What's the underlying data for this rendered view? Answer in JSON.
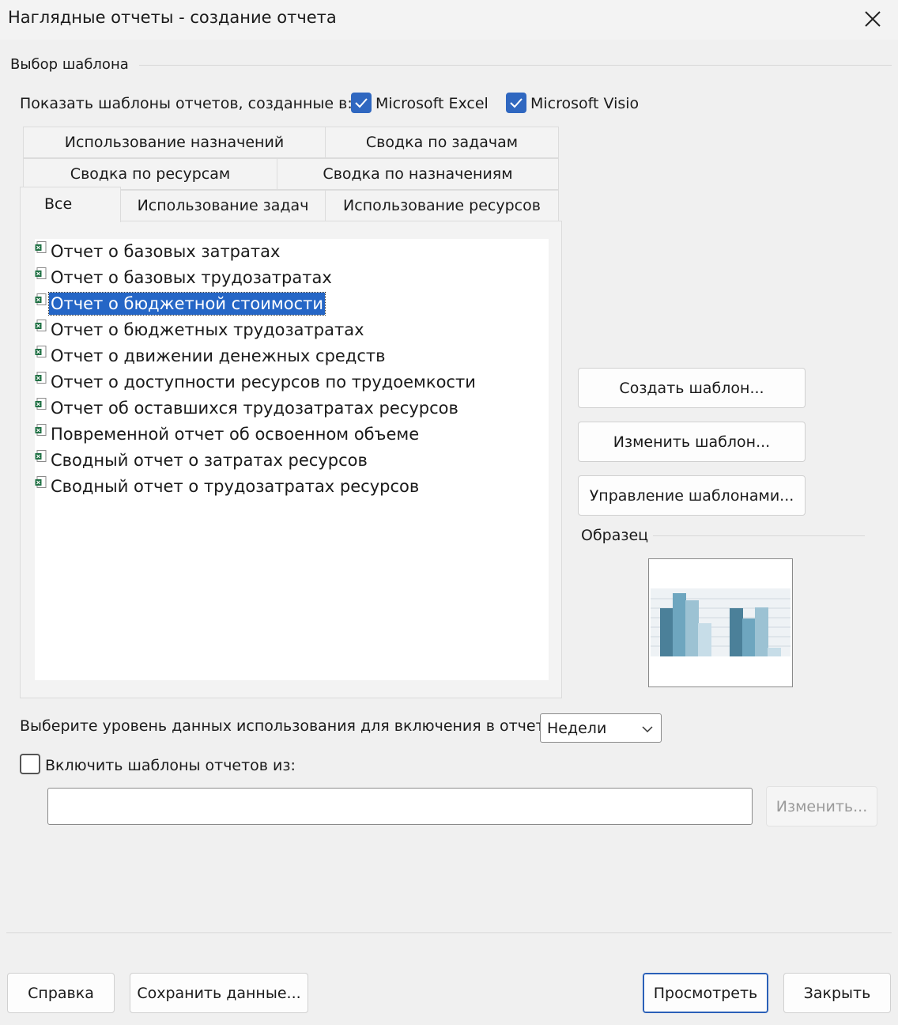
{
  "window": {
    "title": "Наглядные отчеты - создание отчета"
  },
  "template_group": {
    "label": "Выбор шаблона",
    "show_label": "Показать шаблоны отчетов, созданные в:",
    "excel": {
      "label": "Microsoft Excel",
      "checked": true
    },
    "visio": {
      "label": "Microsoft Visio",
      "checked": true
    }
  },
  "tabs": {
    "row1": [
      "Использование назначений",
      "Сводка по задачам"
    ],
    "row2": [
      "Сводка по ресурсам",
      "Сводка по назначениям"
    ],
    "row3": [
      "Все",
      "Использование задач",
      "Использование ресурсов"
    ],
    "active": "Все"
  },
  "reports": [
    "Отчет о базовых затратах",
    "Отчет о базовых трудозатратах",
    "Отчет о бюджетной стоимости",
    "Отчет о бюджетных трудозатратах",
    "Отчет о движении денежных средств",
    "Отчет о доступности ресурсов по трудоемкости",
    "Отчет об оставшихся трудозатратах ресурсов",
    "Повременной отчет об освоенном объеме",
    "Сводный отчет о затратах ресурсов",
    "Сводный отчет о трудозатратах ресурсов"
  ],
  "selected_report": "Отчет о бюджетной стоимости",
  "side_buttons": {
    "create": "Создать шаблон...",
    "edit": "Изменить шаблон...",
    "manage": "Управление шаблонами..."
  },
  "sample": {
    "label": "Образец"
  },
  "usage_level": {
    "label": "Выберите уровень данных использования для включения в отчет:",
    "value": "Недели"
  },
  "include": {
    "label": "Включить шаблоны отчетов из:",
    "checked": false,
    "path": "",
    "modify_button": "Изменить..."
  },
  "footer": {
    "help": "Справка",
    "save": "Сохранить данные...",
    "view": "Просмотреть",
    "close": "Закрыть"
  },
  "colors": {
    "accent": "#2566c6",
    "checkbox": "#2f67c0"
  }
}
